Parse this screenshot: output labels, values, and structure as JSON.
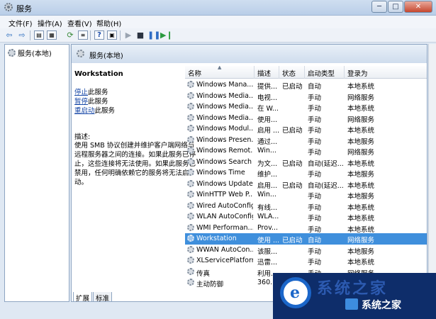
{
  "window": {
    "title": "服务",
    "buttons": [
      "─",
      "□",
      "✕"
    ]
  },
  "menu": [
    "文件(F)",
    "操作(A)",
    "查看(V)",
    "帮助(H)"
  ],
  "toolbar": {
    "help_label": "?",
    "icons": [
      "back-arrow-icon",
      "forward-arrow-icon",
      "console-tree-icon",
      "properties-icon",
      "refresh-icon",
      "export-icon",
      "help-icon",
      "show-hide-icon",
      "start-icon",
      "stop-icon",
      "pause-icon",
      "restart-icon"
    ]
  },
  "tree": {
    "root": "服务(本地)"
  },
  "pane": {
    "title": "服务(本地)",
    "selected_service": "Workstation",
    "links": [
      {
        "link": "停止",
        "rest": "此服务"
      },
      {
        "link": "暂停",
        "rest": "此服务"
      },
      {
        "link": "重启动",
        "rest": "此服务"
      }
    ],
    "description_label": "描述:",
    "description": "使用 SMB 协议创建并维护客户端网络与远程服务器之间的连接。如果此服务已停止，这些连接将无法使用。如果此服务已禁用，任何明确依赖它的服务将无法启动。",
    "tabs": [
      "扩展",
      "标准"
    ]
  },
  "columns": [
    "名称",
    "描述",
    "状态",
    "启动类型",
    "登录为"
  ],
  "services": [
    {
      "name": "Windows Mana...",
      "desc": "提供...",
      "status": "已启动",
      "startup": "自动",
      "logon": "本地系统"
    },
    {
      "name": "Windows Media...",
      "desc": "电视...",
      "status": "",
      "startup": "手动",
      "logon": "网络服务"
    },
    {
      "name": "Windows Media...",
      "desc": "在 W...",
      "status": "",
      "startup": "手动",
      "logon": "本地系统"
    },
    {
      "name": "Windows Media...",
      "desc": "使用...",
      "status": "",
      "startup": "手动",
      "logon": "网络服务"
    },
    {
      "name": "Windows Modul...",
      "desc": "启用 ...",
      "status": "已启动",
      "startup": "手动",
      "logon": "本地系统"
    },
    {
      "name": "Windows Presen...",
      "desc": "通过...",
      "status": "",
      "startup": "手动",
      "logon": "本地服务"
    },
    {
      "name": "Windows Remot...",
      "desc": "Win...",
      "status": "",
      "startup": "手动",
      "logon": "网络服务"
    },
    {
      "name": "Windows Search",
      "desc": "为文...",
      "status": "已启动",
      "startup": "自动(延迟...",
      "logon": "本地系统"
    },
    {
      "name": "Windows Time",
      "desc": "维护...",
      "status": "",
      "startup": "手动",
      "logon": "本地服务"
    },
    {
      "name": "Windows Update",
      "desc": "启用...",
      "status": "已启动",
      "startup": "自动(延迟...",
      "logon": "本地系统"
    },
    {
      "name": "WinHTTP Web P...",
      "desc": "Win...",
      "status": "",
      "startup": "手动",
      "logon": "本地服务"
    },
    {
      "name": "Wired AutoConfig",
      "desc": "有线...",
      "status": "",
      "startup": "手动",
      "logon": "本地系统"
    },
    {
      "name": "WLAN AutoConfig",
      "desc": "WLA...",
      "status": "",
      "startup": "手动",
      "logon": "本地系统"
    },
    {
      "name": "WMI Performan...",
      "desc": "Prov...",
      "status": "",
      "startup": "手动",
      "logon": "本地系统"
    },
    {
      "name": "Workstation",
      "desc": "使用 ...",
      "status": "已启动",
      "startup": "自动",
      "logon": "网络服务",
      "selected": true
    },
    {
      "name": "WWAN AutoCon...",
      "desc": "该服...",
      "status": "",
      "startup": "手动",
      "logon": "本地服务"
    },
    {
      "name": "XLServicePlatform",
      "desc": "迅雷...",
      "status": "",
      "startup": "手动",
      "logon": "本地系统"
    },
    {
      "name": "传真",
      "desc": "利用...",
      "status": "",
      "startup": "手动",
      "logon": "网络服务"
    },
    {
      "name": "主动防御",
      "desc": "360...",
      "status": "",
      "startup": "",
      "logon": ""
    }
  ],
  "watermark": {
    "logo_letter": "e",
    "faint_text": "系统之家",
    "text": "系统之家"
  }
}
